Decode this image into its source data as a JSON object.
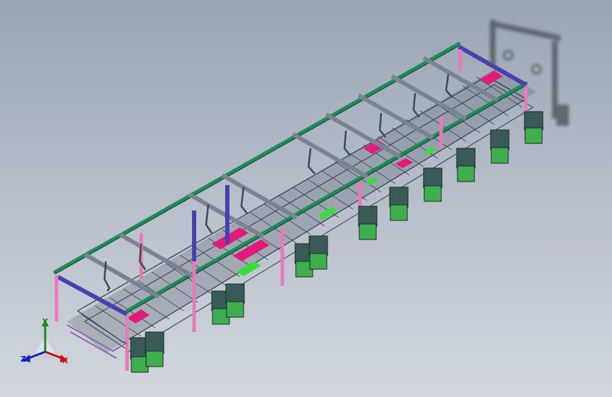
{
  "triad": {
    "x_label": "X",
    "y_label": "Y",
    "z_label": "Z"
  },
  "colors": {
    "frame_green": "#1f8a5a",
    "leg_pink": "#e87ab8",
    "brace_blue": "#4b3fb0",
    "cabinet": "#3a5a58",
    "cabinet_green": "#3fae4f",
    "highlight": "#e21a7a",
    "conveyor": "#5a6470",
    "x_axis": "#c81010",
    "y_axis": "#1a8a1a",
    "z_axis": "#1020c0"
  }
}
